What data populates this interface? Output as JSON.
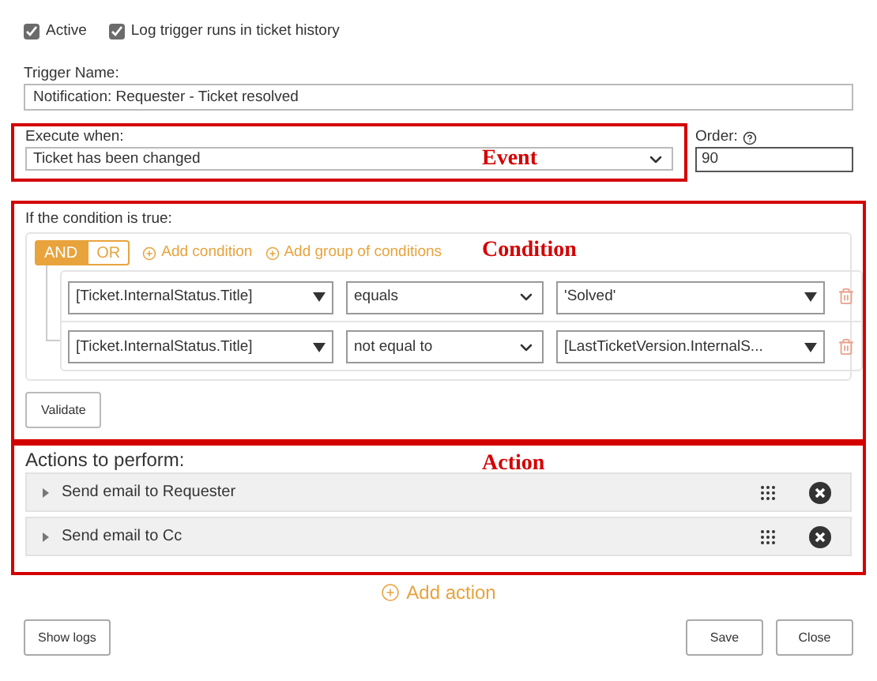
{
  "checkboxes": [
    {
      "label": "Active",
      "checked": true
    },
    {
      "label": "Log trigger runs in ticket history",
      "checked": true
    }
  ],
  "trigger_name": {
    "label": "Trigger Name:",
    "value": "Notification: Requester - Ticket resolved"
  },
  "execute_when": {
    "label": "Execute when:",
    "value": "Ticket has been changed",
    "annotation": "Event"
  },
  "order": {
    "label": "Order:",
    "value": "90"
  },
  "condition": {
    "label": "If the condition is true:",
    "annotation": "Condition",
    "operators": [
      {
        "label": "AND",
        "selected": true
      },
      {
        "label": "OR",
        "selected": false
      }
    ],
    "add_links": [
      "Add condition",
      "Add group of conditions"
    ],
    "rows": [
      {
        "field": "[Ticket.InternalStatus.Title]",
        "operator": "equals",
        "value": "'Solved'"
      },
      {
        "field": "[Ticket.InternalStatus.Title]",
        "operator": "not equal to",
        "value": "[LastTicketVersion.InternalS..."
      }
    ],
    "validate": "Validate"
  },
  "actions": {
    "label": "Actions to perform:",
    "annotation": "Action",
    "items": [
      "Send email to Requester",
      "Send email to Cc"
    ],
    "add": "Add action"
  },
  "footer": {
    "left": [
      "Show logs"
    ],
    "right": [
      "Save",
      "Close"
    ]
  }
}
